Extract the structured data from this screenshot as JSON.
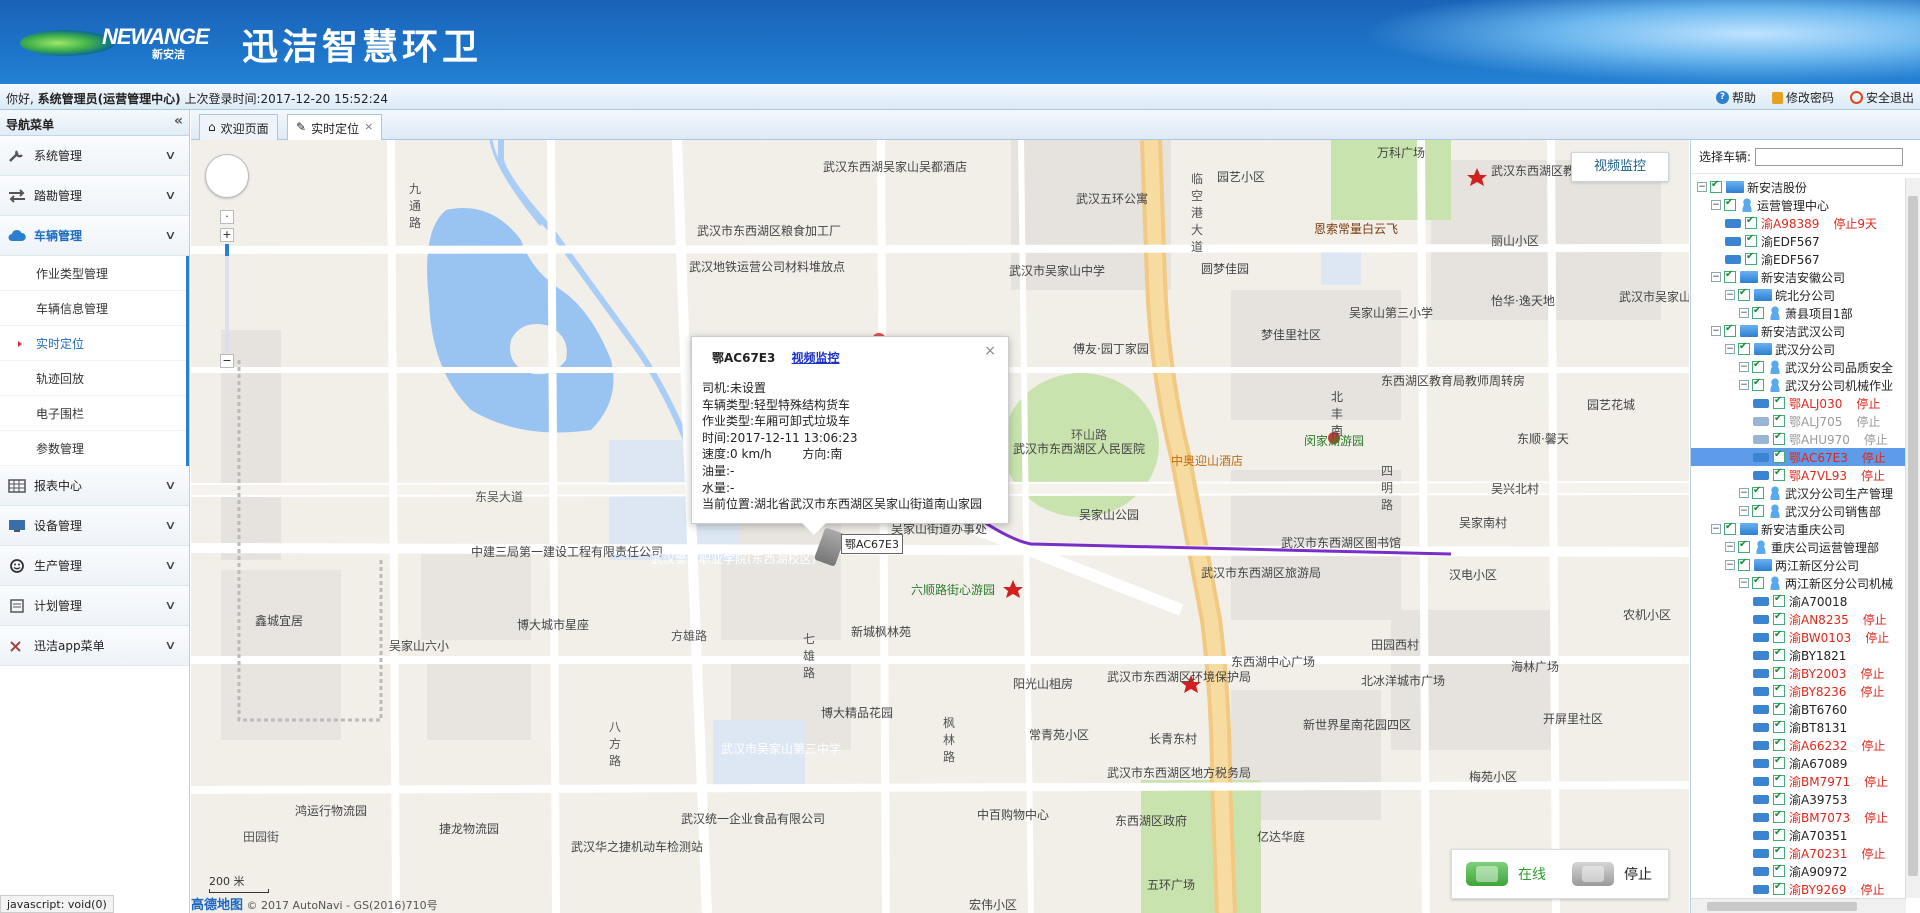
{
  "header": {
    "logo_text": "NEWANGE",
    "logo_cn": "新安洁",
    "title": "迅洁智慧环卫"
  },
  "infobar": {
    "greet_prefix": "你好,",
    "user": "系统管理员(运营管理中心)",
    "last_login": "上次登录时间:2017-12-20 15:52:24",
    "help": "帮助",
    "change_password": "修改密码",
    "logout": "安全退出"
  },
  "sidebar": {
    "title": "导航菜单",
    "collapse_icon": "«",
    "groups": [
      {
        "label": "系统管理"
      },
      {
        "label": "踏勘管理"
      },
      {
        "label": "车辆管理"
      },
      {
        "label": "报表中心"
      },
      {
        "label": "设备管理"
      },
      {
        "label": "生产管理"
      },
      {
        "label": "计划管理"
      },
      {
        "label": "迅洁app菜单"
      }
    ],
    "vehicle_sub": [
      "作业类型管理",
      "车辆信息管理",
      "实时定位",
      "轨迹回放",
      "电子围栏",
      "参数管理"
    ]
  },
  "tabs": [
    {
      "label": "欢迎页面"
    },
    {
      "label": "实时定位",
      "close": "×"
    }
  ],
  "map": {
    "video_button": "视频监控",
    "scale": "200 米",
    "copyright_logo": "高德地图",
    "copyright": "© 2017 AutoNavi - GS(2016)710号",
    "legend_online": "在线",
    "legend_stopped": "停止",
    "labels": [
      "武汉东西湖吴家山吴都酒店",
      "武汉五环公寓",
      "武汉市东西湖区粮食加工厂",
      "武汉地铁运营公司材料堆放点",
      "武汉市吴家山中学",
      "圆梦佳园",
      "恩索常量白云飞",
      "丽山小区",
      "吴家山第三小学",
      "怡华·逸天地",
      "梦佳里社区",
      "傅友·园丁家园",
      "东西湖区教育局教师周转房",
      "闵家湖游园",
      "中奥迎山酒店",
      "吴家山公园",
      "武汉市东西湖区图书馆",
      "武汉市东西湖区旅游局",
      "东西湖中心广场",
      "田园西村",
      "六顺路街心游园",
      "中建三局第一建设工程有限责任公司",
      "武汉警官职业学院(东西湖校区)",
      "博大城市星座",
      "鑫城宜居",
      "吴家山六小",
      "新城枫林苑",
      "阳光山柤房",
      "武汉市东西湖区环境保护局",
      "北冰洋城市广场",
      "博大精品花园",
      "武汉市吴家山第三中学",
      "常青苑小区",
      "长青东村",
      "武汉市东西湖区地方税务局",
      "鸿运行物流园",
      "捷龙物流园",
      "武汉统一企业食品有限公司",
      "武汉华之捷机动车检测站",
      "中百购物中心",
      "东西湖区政府",
      "五环广场",
      "宏伟小区",
      "梅苑小区",
      "开屏里社区",
      "农机小区",
      "东吴大道",
      "临空港大道",
      "环山路",
      "吴兴北村",
      "吴家南村",
      "汉电小区",
      "东顺·馨天",
      "园艺花城",
      "四明路",
      "九通路",
      "七雄路",
      "八方路",
      "田园街",
      "枫林路",
      "方雄路",
      "亿达华庭",
      "海林广场",
      "新世界星南花园四区",
      "武汉市东西湖区人民医院",
      "吴家山街道办事处",
      "武汉东西湖区教育局",
      "万科广场",
      "园艺小区",
      "北丰南",
      "武汉市吴家山第四中学"
    ]
  },
  "popup": {
    "plate": "鄂AC67E3",
    "video_link": "视频监控",
    "close": "×",
    "rows": [
      "司机:未设置",
      "车辆类型:轻型特殊结构货车",
      "作业类型:车厢可卸式垃圾车",
      "时间:2017-12-11 13:06:23",
      "速度:0 km/h        方向:南",
      "油量:-",
      "水量:-",
      "当前位置:湖北省武汉市东西湖区吴家山街道南山家园"
    ],
    "marker_plate": "鄂AC67E3"
  },
  "right_panel": {
    "select_label": "选择车辆:",
    "search_value": "",
    "tree": [
      {
        "level": 0,
        "type": "folder",
        "label": "新安洁股份"
      },
      {
        "level": 1,
        "type": "person",
        "label": "运营管理中心"
      },
      {
        "level": 2,
        "type": "truck",
        "label": "渝A98389",
        "color": "red",
        "status": "停止9天"
      },
      {
        "level": 2,
        "type": "truck",
        "label": "渝EDF567"
      },
      {
        "level": 2,
        "type": "truck",
        "label": "渝EDF567"
      },
      {
        "level": 1,
        "type": "folder",
        "label": "新安洁安徽公司"
      },
      {
        "level": 2,
        "type": "folder",
        "label": "皖北分公司"
      },
      {
        "level": 3,
        "type": "person",
        "label": "萧县项目1部"
      },
      {
        "level": 1,
        "type": "folder",
        "label": "新安洁武汉公司"
      },
      {
        "level": 2,
        "type": "folder",
        "label": "武汉分公司"
      },
      {
        "level": 3,
        "type": "person",
        "label": "武汉分公司品质安全"
      },
      {
        "level": 3,
        "type": "person",
        "label": "武汉分公司机械作业"
      },
      {
        "level": 4,
        "type": "truck",
        "label": "鄂ALJ030",
        "color": "red",
        "status": "停止"
      },
      {
        "level": 4,
        "type": "truck",
        "label": "鄂ALJ705",
        "color": "gray",
        "status": "停止"
      },
      {
        "level": 4,
        "type": "truck",
        "label": "鄂AHU970",
        "color": "gray",
        "status": "停止"
      },
      {
        "level": 4,
        "type": "truck",
        "label": "鄂AC67E3",
        "color": "red",
        "status": "停止",
        "selected": true
      },
      {
        "level": 4,
        "type": "truck",
        "label": "鄂A7VL93",
        "color": "red",
        "status": "停止"
      },
      {
        "level": 3,
        "type": "person",
        "label": "武汉分公司生产管理"
      },
      {
        "level": 3,
        "type": "person",
        "label": "武汉分公司销售部"
      },
      {
        "level": 1,
        "type": "folder",
        "label": "新安洁重庆公司"
      },
      {
        "level": 2,
        "type": "person",
        "label": "重庆公司运营管理部"
      },
      {
        "level": 2,
        "type": "folder",
        "label": "两江新区分公司"
      },
      {
        "level": 3,
        "type": "person",
        "label": "两江新区分公司机械"
      },
      {
        "level": 4,
        "type": "truck",
        "label": "渝A70018"
      },
      {
        "level": 4,
        "type": "truck",
        "label": "渝AN8235",
        "color": "red",
        "status": "停止"
      },
      {
        "level": 4,
        "type": "truck",
        "label": "渝BW0103",
        "color": "red",
        "status": "停止"
      },
      {
        "level": 4,
        "type": "truck",
        "label": "渝BY1821"
      },
      {
        "level": 4,
        "type": "truck",
        "label": "渝BY2003",
        "color": "red",
        "status": "停止"
      },
      {
        "level": 4,
        "type": "truck",
        "label": "渝BY8236",
        "color": "red",
        "status": "停止"
      },
      {
        "level": 4,
        "type": "truck",
        "label": "渝BT6760"
      },
      {
        "level": 4,
        "type": "truck",
        "label": "渝BT8131"
      },
      {
        "level": 4,
        "type": "truck",
        "label": "渝A66232",
        "color": "red",
        "status": "停止"
      },
      {
        "level": 4,
        "type": "truck",
        "label": "渝A67089"
      },
      {
        "level": 4,
        "type": "truck",
        "label": "渝BM7971",
        "color": "red",
        "status": "停止"
      },
      {
        "level": 4,
        "type": "truck",
        "label": "渝A39753"
      },
      {
        "level": 4,
        "type": "truck",
        "label": "渝BM7073",
        "color": "red",
        "status": "停止"
      },
      {
        "level": 4,
        "type": "truck",
        "label": "渝A70351"
      },
      {
        "level": 4,
        "type": "truck",
        "label": "渝A70231",
        "color": "red",
        "status": "停止"
      },
      {
        "level": 4,
        "type": "truck",
        "label": "渝A90972"
      },
      {
        "level": 4,
        "type": "truck",
        "label": "渝BY9269",
        "color": "red",
        "status": "停止"
      }
    ]
  },
  "statusbar": "javascript: void(0)"
}
